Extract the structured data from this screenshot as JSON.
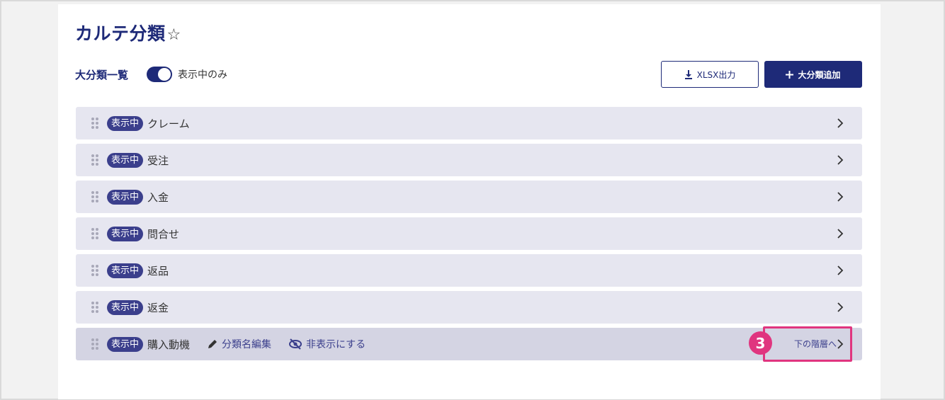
{
  "page": {
    "title": "カルテ分類",
    "favorite_icon": "star-outline-icon"
  },
  "toolbar": {
    "list_label": "大分類一覧",
    "toggle_label": "表示中のみ",
    "toggle_on": true,
    "export_label": "XLSX出力",
    "add_label": "大分類追加"
  },
  "categories": [
    {
      "status": "表示中",
      "name": "クレーム"
    },
    {
      "status": "表示中",
      "name": "受注"
    },
    {
      "status": "表示中",
      "name": "入金"
    },
    {
      "status": "表示中",
      "name": "問合せ"
    },
    {
      "status": "表示中",
      "name": "返品"
    },
    {
      "status": "表示中",
      "name": "返金"
    },
    {
      "status": "表示中",
      "name": "購入動機"
    }
  ],
  "active_row": {
    "edit_label": "分類名編集",
    "hide_label": "非表示にする",
    "next_label": "下の階層へ"
  },
  "annotation": {
    "step": "3",
    "color": "#e0357f"
  },
  "colors": {
    "primary": "#1e2a78",
    "row_bg": "#e6e6f0",
    "badge": "#3b3f8c"
  }
}
